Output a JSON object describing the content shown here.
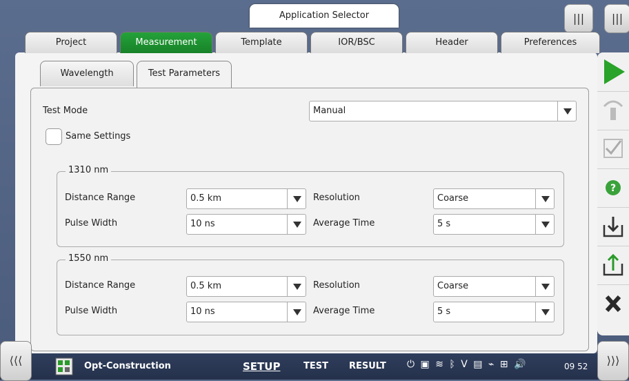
{
  "app_selector": {
    "label": "Application Selector"
  },
  "top_tabs": [
    {
      "label": "Project"
    },
    {
      "label": "Measurement"
    },
    {
      "label": "Template"
    },
    {
      "label": "IOR/BSC"
    },
    {
      "label": "Header"
    },
    {
      "label": "Preferences"
    }
  ],
  "sub_tabs": [
    {
      "label": "Wavelength"
    },
    {
      "label": "Test Parameters"
    }
  ],
  "test_mode": {
    "label": "Test Mode",
    "value": "Manual"
  },
  "same_settings": {
    "label": "Same Settings",
    "checked": false
  },
  "groups": [
    {
      "title": "1310 nm",
      "distance_range": {
        "label": "Distance Range",
        "value": "0.5 km"
      },
      "resolution": {
        "label": "Resolution",
        "value": "Coarse"
      },
      "pulse_width": {
        "label": "Pulse Width",
        "value": "10 ns"
      },
      "average_time": {
        "label": "Average Time",
        "value": "5 s"
      }
    },
    {
      "title": "1550 nm",
      "distance_range": {
        "label": "Distance Range",
        "value": "0.5 km"
      },
      "resolution": {
        "label": "Resolution",
        "value": "Coarse"
      },
      "pulse_width": {
        "label": "Pulse Width",
        "value": "10 ns"
      },
      "average_time": {
        "label": "Average Time",
        "value": "5 s"
      }
    }
  ],
  "right_toolbar": {
    "icons": [
      "play-icon",
      "probe-icon",
      "check-icon",
      "help-icon",
      "load-icon",
      "save-icon",
      "close-icon"
    ],
    "help_label": "?"
  },
  "top_buttons": {
    "left": "|||",
    "right": "|||"
  },
  "bottom_bar": {
    "left_btn": "⟨⟨⟨",
    "right_btn": "⟩⟩⟩",
    "app_name": "Opt-Construction",
    "setup": "SETUP",
    "test": "TEST",
    "result": "RESULT",
    "volume": "🔊",
    "time": "09 52"
  },
  "colors": {
    "accent_green": "#1f9a35",
    "play_green": "#29a329",
    "help_green": "#3aa23a",
    "close_dark": "#2a2a2a"
  }
}
